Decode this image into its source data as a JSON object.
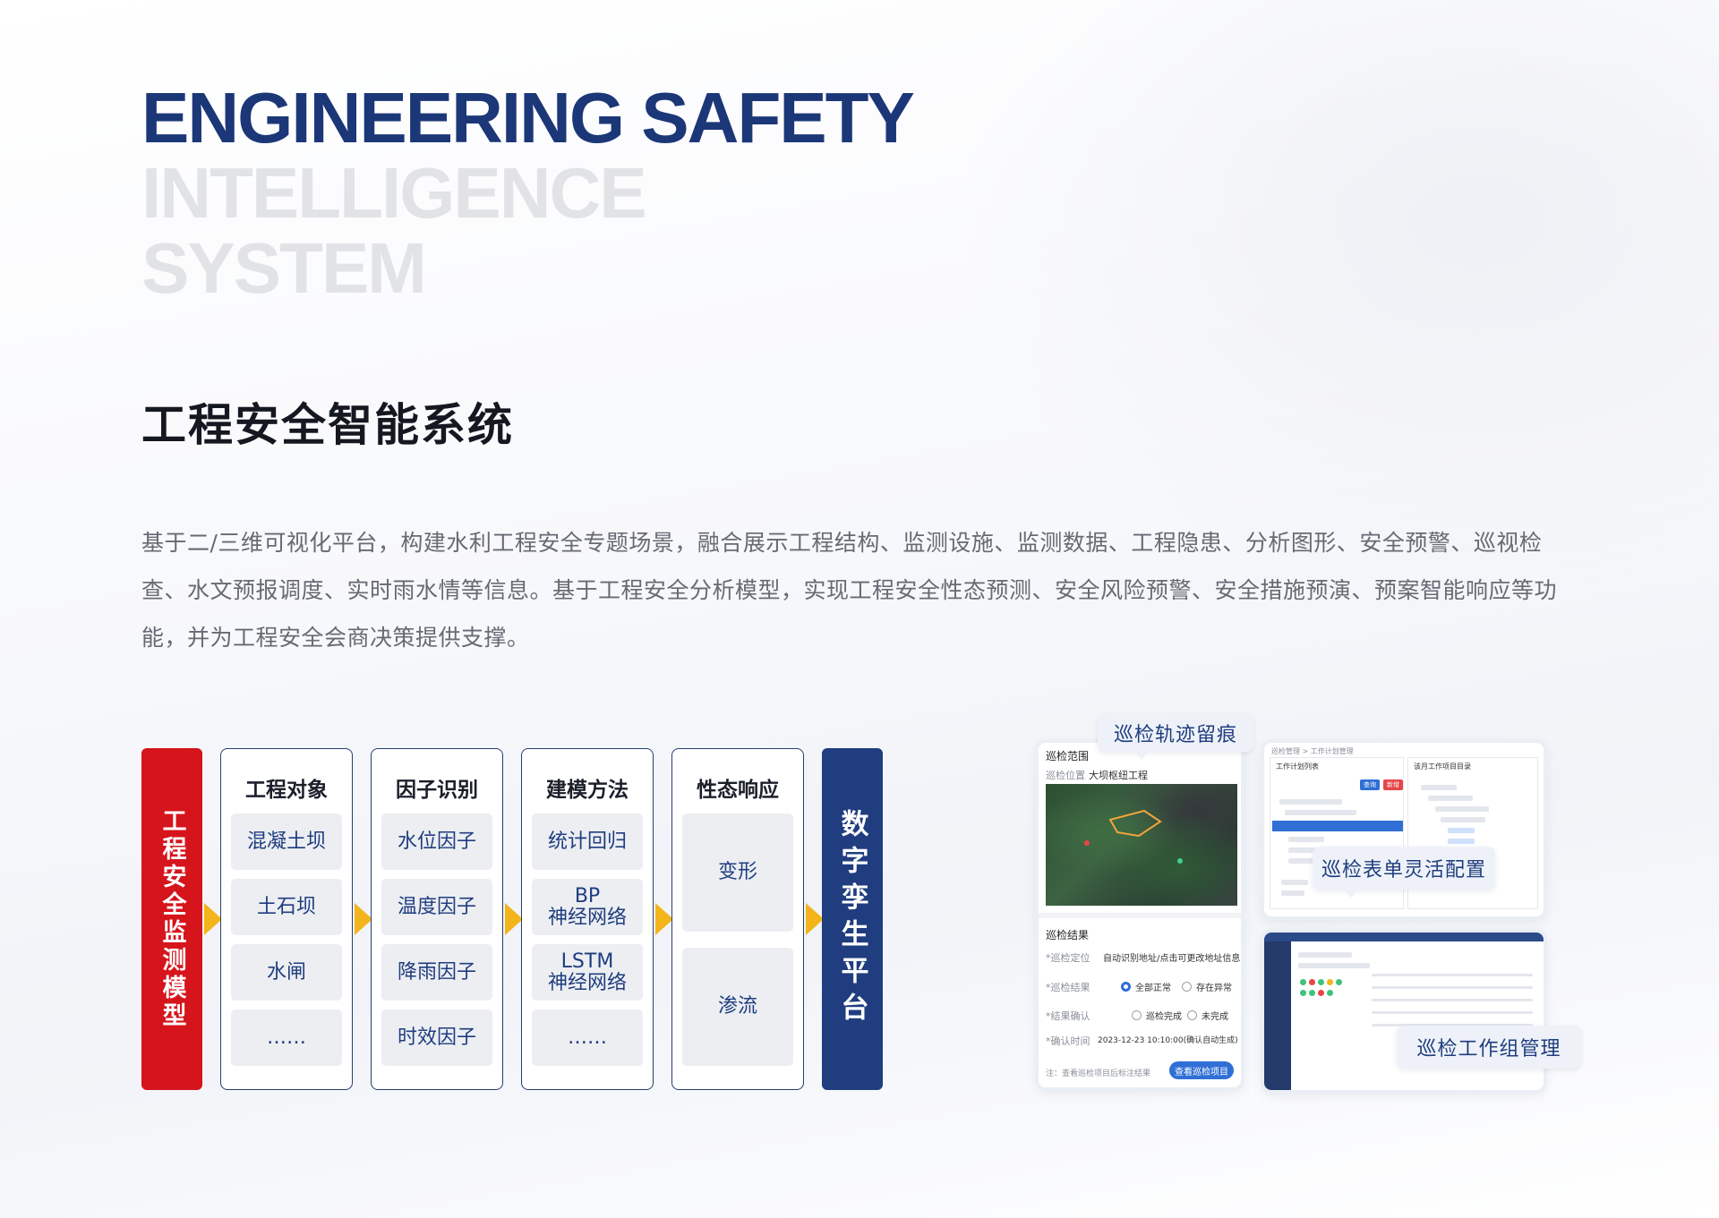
{
  "hero": {
    "line1": "ENGINEERING SAFETY",
    "line2": "INTELLIGENCE",
    "line3": "SYSTEM"
  },
  "title": "工程安全智能系统",
  "description": "基于二/三维可视化平台，构建水利工程安全专题场景，融合展示工程结构、监测设施、监测数据、工程隐患、分析图形、安全预警、巡视检查、水文预报调度、实时雨水情等信息。基于工程安全分析模型，实现工程安全性态预测、安全风险预警、安全措施预演、预案智能响应等功能，并为工程安全会商决策提供支撑。",
  "diagram": {
    "left_bar": "工程安全监测模型",
    "right_bar": "数字孪生平台",
    "columns": [
      {
        "title": "工程对象",
        "cells": [
          "混凝土坝",
          "土石坝",
          "水闸",
          "……"
        ]
      },
      {
        "title": "因子识别",
        "cells": [
          "水位因子",
          "温度因子",
          "降雨因子",
          "时效因子"
        ]
      },
      {
        "title": "建模方法",
        "cells": [
          "统计回归",
          "BP\n神经网络",
          "LSTM\n神经网络",
          "……"
        ]
      },
      {
        "title": "性态响应",
        "cells": [
          "变形",
          "渗流"
        ]
      }
    ],
    "colors": {
      "red": "#d6141c",
      "navy": "#1f3d7f",
      "arrow": "#f3b51b"
    }
  },
  "screens": {
    "tags": [
      "巡检轨迹留痕",
      "巡检表单灵活配置",
      "巡检工作组管理"
    ],
    "patrol": {
      "range_label": "巡检范围",
      "range_field": "巡检位置",
      "range_value": "大坝枢纽工程",
      "result_label": "巡检结果",
      "rows": [
        {
          "label": "*巡检定位",
          "value": "自动识别地址/点击可更改地址信息"
        },
        {
          "label": "*巡检结果",
          "opt1": "全部正常",
          "opt2": "存在异常"
        },
        {
          "label": "*结果确认",
          "opt1": "巡检完成",
          "opt2": "未完成"
        },
        {
          "label": "*确认时间",
          "value": "2023-12-23 10:10:00(确认自动生成)"
        }
      ],
      "note": "注：查看巡检项目后标注结果",
      "button": "查看巡检项目"
    },
    "form": {
      "breadcrumb": "巡检管理 > 工作计划管理",
      "left_title": "工作计划列表",
      "right_title": "该月工作项目目录",
      "btn1": "查询",
      "btn2": "新增"
    }
  }
}
